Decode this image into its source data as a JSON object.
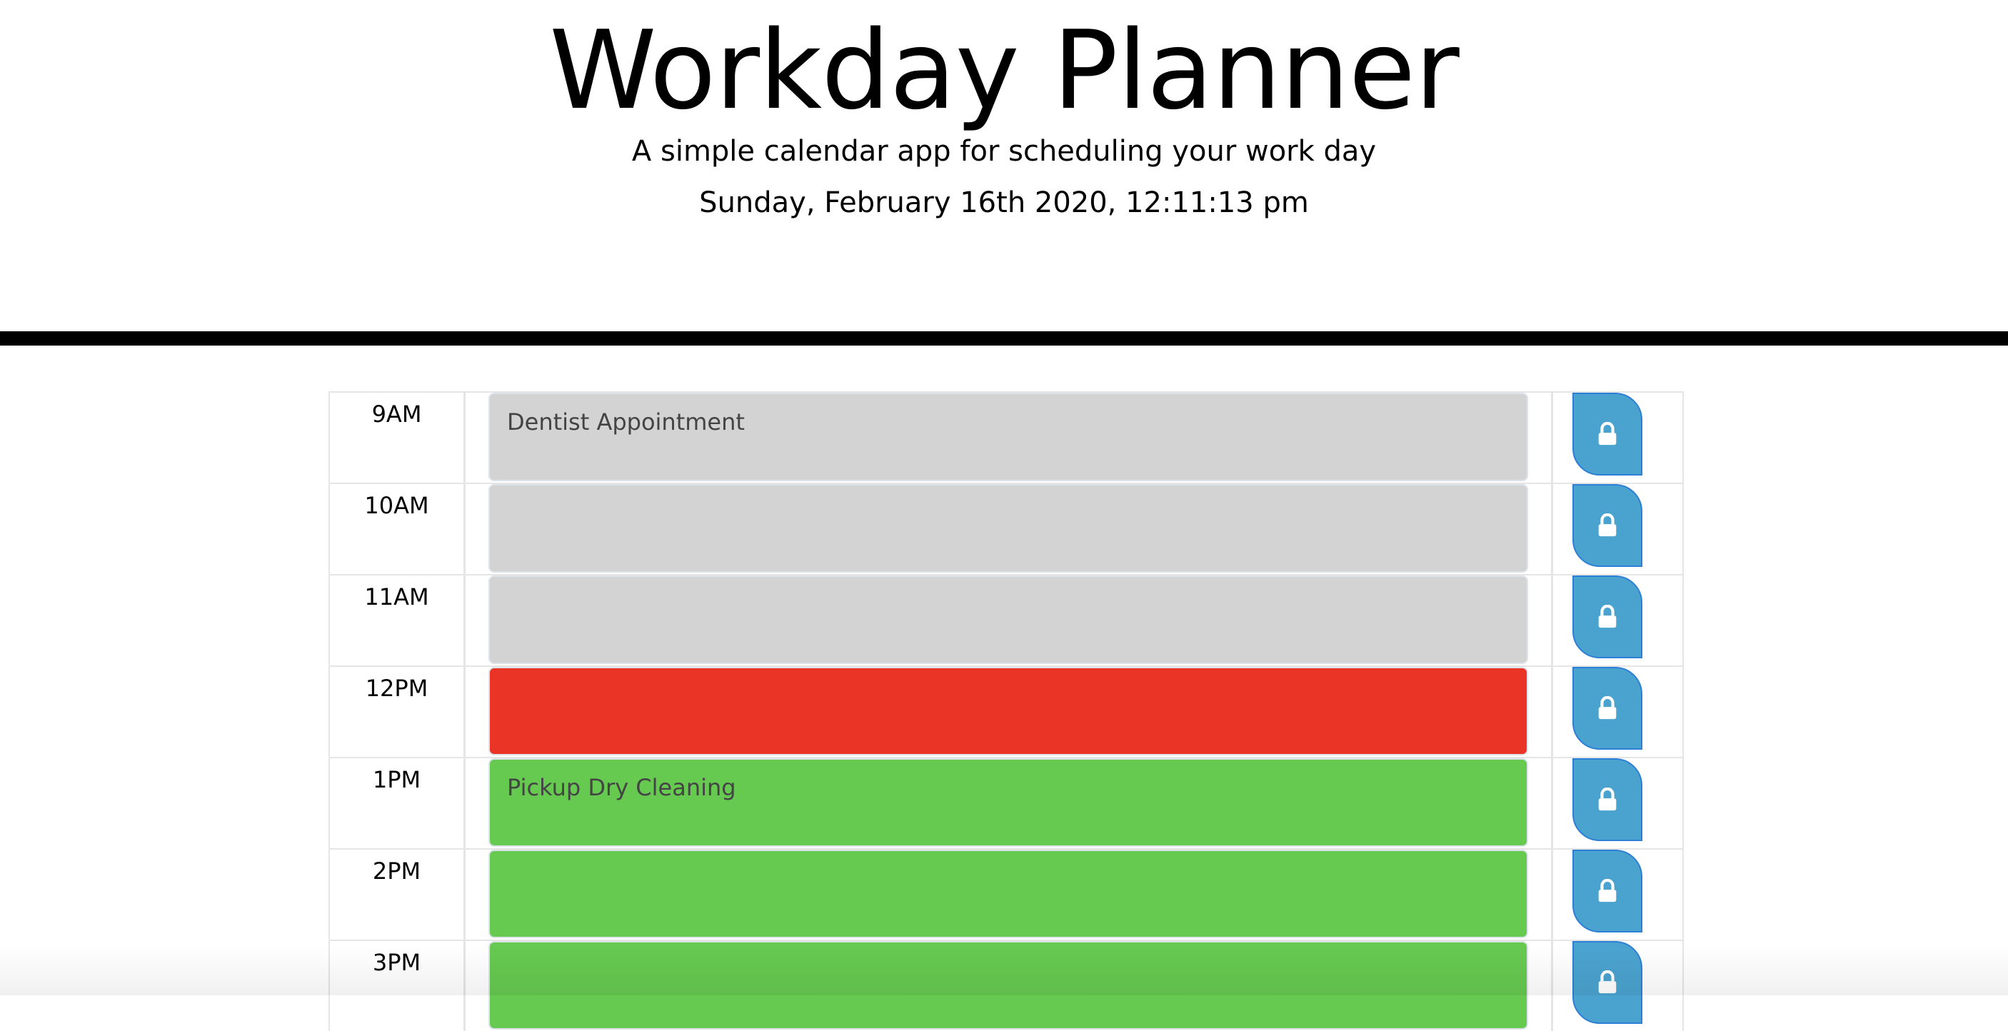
{
  "header": {
    "title": "Workday Planner",
    "subtitle": "A simple calendar app for scheduling your work day",
    "current_day": "Sunday, February 16th 2020, 12:11:13 pm"
  },
  "colors": {
    "past": "#d3d3d3",
    "present": "#e93426",
    "future": "#66c950",
    "save_button": "#4aa3cf"
  },
  "time_blocks": [
    {
      "hour": "9AM",
      "text": "Dentist Appointment",
      "state": "past",
      "icon": "lock-icon"
    },
    {
      "hour": "10AM",
      "text": "",
      "state": "past",
      "icon": "lock-icon"
    },
    {
      "hour": "11AM",
      "text": "",
      "state": "past",
      "icon": "lock-icon"
    },
    {
      "hour": "12PM",
      "text": "",
      "state": "present",
      "icon": "lock-icon"
    },
    {
      "hour": "1PM",
      "text": "Pickup Dry Cleaning",
      "state": "future",
      "icon": "lock-icon"
    },
    {
      "hour": "2PM",
      "text": "",
      "state": "future",
      "icon": "lock-icon"
    },
    {
      "hour": "3PM",
      "text": "",
      "state": "future",
      "icon": "lock-icon"
    }
  ]
}
